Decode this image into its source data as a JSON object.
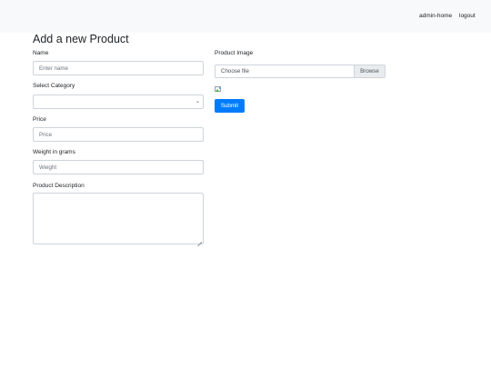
{
  "nav": {
    "admin_home": "admin-home",
    "logout": "logout"
  },
  "page": {
    "title": "Add a new Product"
  },
  "form": {
    "name": {
      "label": "Name",
      "placeholder": "Enter name",
      "value": ""
    },
    "category": {
      "label": "Select Category",
      "selected": ""
    },
    "price": {
      "label": "Price",
      "placeholder": "Price",
      "value": ""
    },
    "weight": {
      "label": "Weight in grams",
      "placeholder": "Weight",
      "value": ""
    },
    "description": {
      "label": "Product Description",
      "value": ""
    },
    "image": {
      "label": "Product Image",
      "file_text": "Choose file",
      "browse_label": "Browse"
    },
    "submit_label": "Submit"
  },
  "colors": {
    "navbar_bg": "#f8f9fa",
    "primary": "#007bff",
    "border": "#ced4da",
    "browse_bg": "#e9ecef"
  },
  "icons": {
    "broken_image": "broken-image-icon",
    "select_chevron": "chevron-down-icon"
  }
}
